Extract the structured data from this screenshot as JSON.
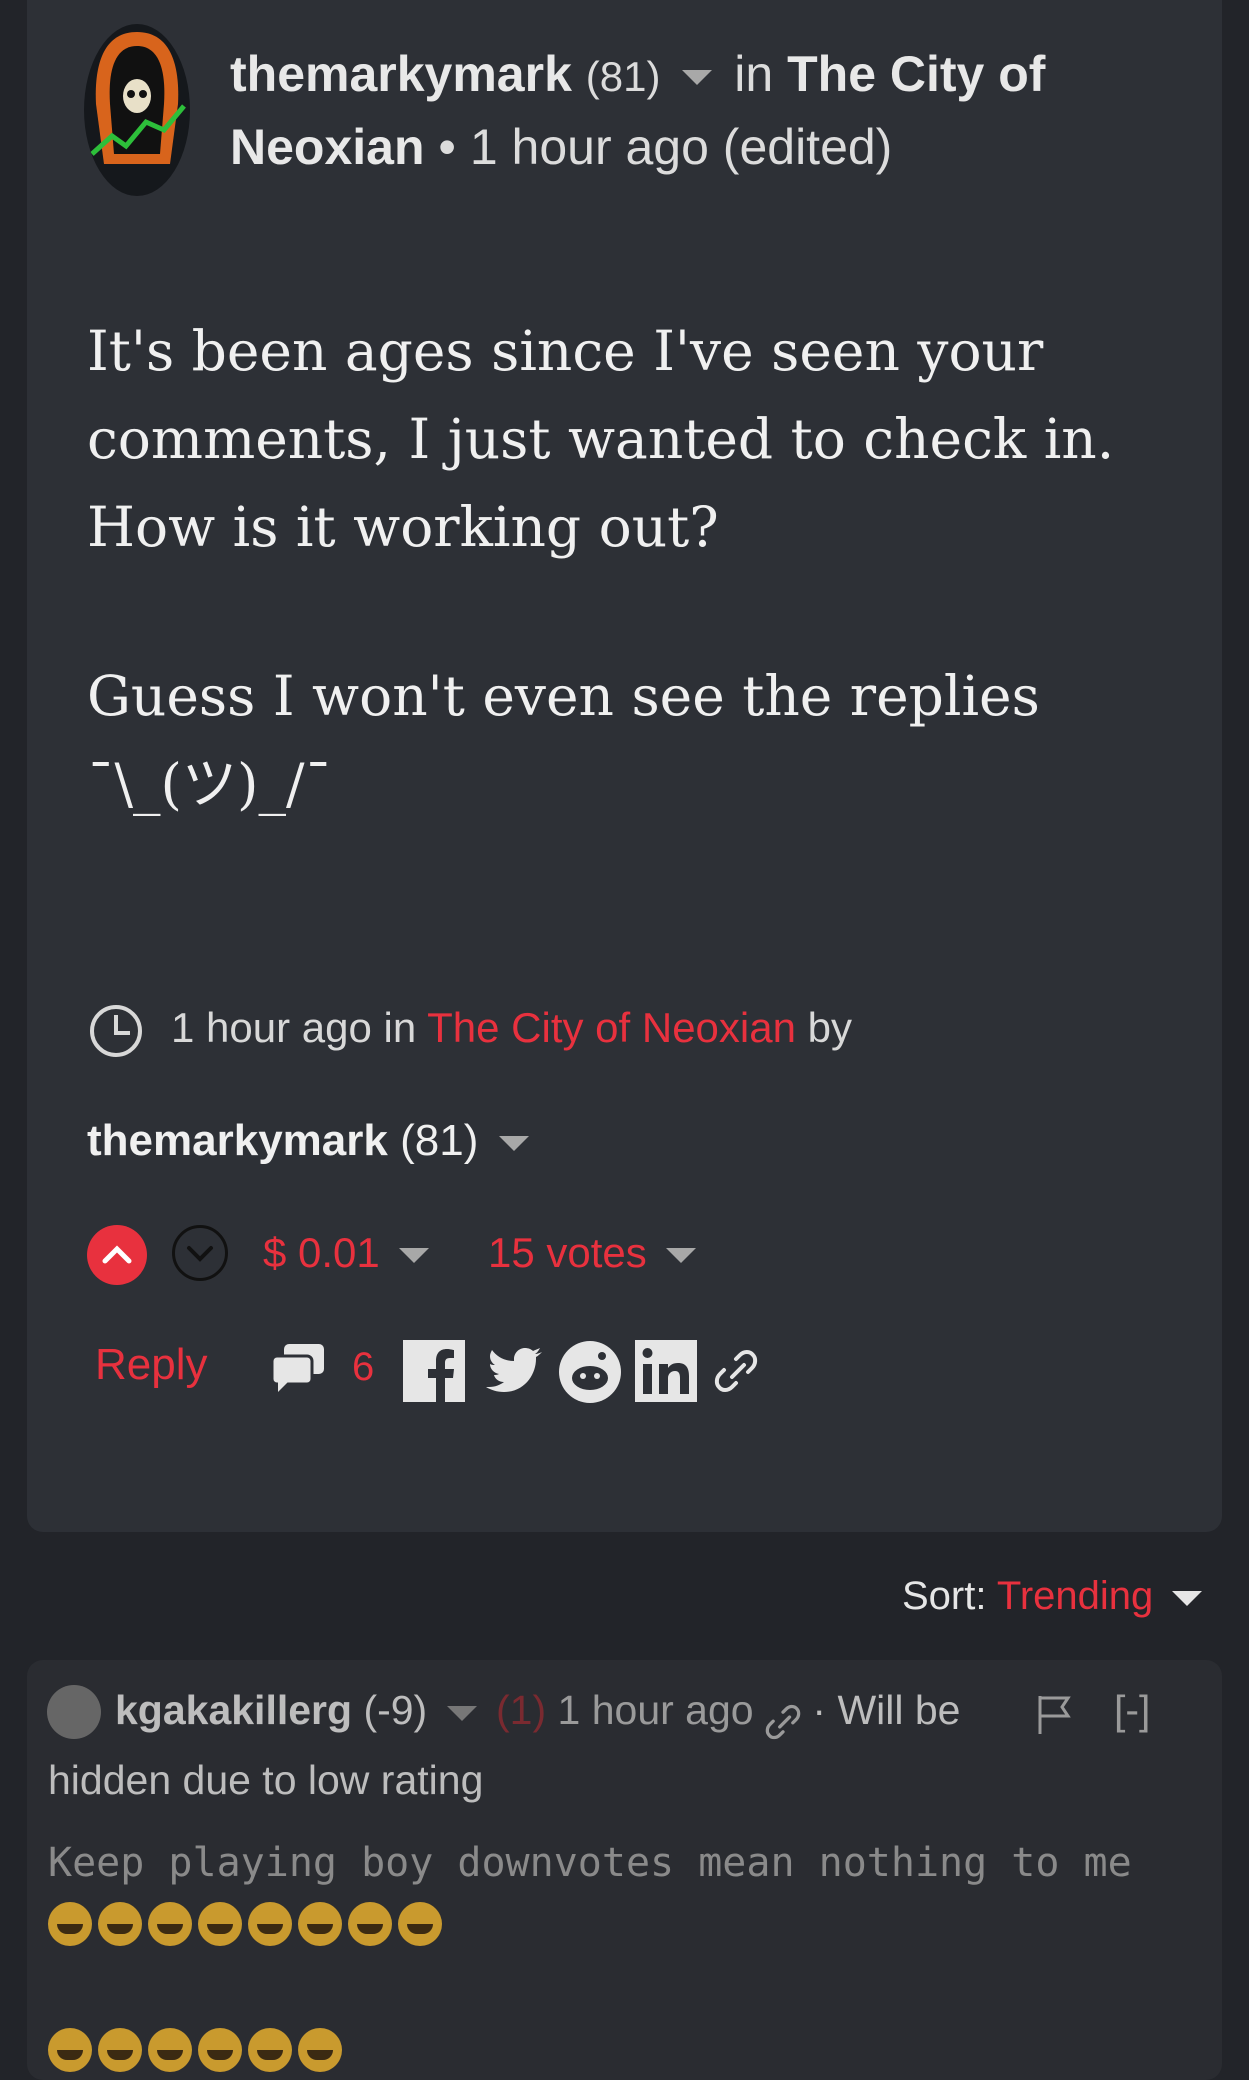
{
  "post": {
    "author": "themarkymark",
    "reputation": "(81)",
    "in_word": "in",
    "community_line1": "The City of",
    "community_line2": "Neoxian",
    "time": "• 1 hour ago (edited)",
    "body_lines": [
      "It's been ages since I've seen your",
      "comments, I just wanted to check in.",
      "How is it working out?",
      "Guess I won't even see the replies",
      "¯\\_(ツ)_/¯"
    ],
    "meta_time": "1 hour ago in",
    "meta_community": "The City of Neoxian",
    "meta_by": "by",
    "footer_author": "themarkymark",
    "footer_reputation": "(81)",
    "payout": "$ 0.01",
    "votes": "15 votes",
    "reply_label": "Reply",
    "comment_count": "6"
  },
  "sort": {
    "label": "Sort:",
    "value": "Trending"
  },
  "reply_comment": {
    "author": "kgakakillerg",
    "reputation": "(-9)",
    "vote_count": "(1)",
    "time": "1 hour ago",
    "status_part1": "· Will be",
    "status_part2": "hidden due to low rating",
    "collapse": "[-]",
    "body": "Keep playing boy downvotes mean nothing to me"
  },
  "colors": {
    "accent": "#e8313e",
    "background": "#222429",
    "card": "#2d3036"
  },
  "icons": [
    "clock-icon",
    "caret-down-icon",
    "upvote-icon",
    "downvote-icon",
    "comments-icon",
    "facebook-icon",
    "twitter-icon",
    "reddit-icon",
    "linkedin-icon",
    "link-icon",
    "flag-icon"
  ]
}
